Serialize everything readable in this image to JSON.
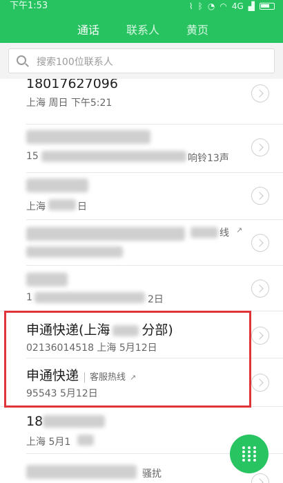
{
  "status": {
    "time": "下午1:53",
    "signal": "4G"
  },
  "tabs": [
    {
      "label": "通话",
      "active": true
    },
    {
      "label": "联系人",
      "active": false
    },
    {
      "label": "黄页",
      "active": false
    }
  ],
  "search": {
    "placeholder": "搜索100位联系人"
  },
  "calls": [
    {
      "line1": "18017627096",
      "line2": "上海 周日 下午5:21"
    },
    {
      "line1": "",
      "line2": "15",
      "extra": "响铃13声"
    },
    {
      "line1": "",
      "line2": "上海",
      "extra": "日"
    },
    {
      "line1": "",
      "line2": "",
      "extra": "线"
    },
    {
      "line1": "",
      "line2": "1",
      "extra": "2日"
    },
    {
      "line1": "申通快递(上海",
      "line1_tail": "分部)",
      "line2": "02136014518 上海 5月12日"
    },
    {
      "line1": "申通快递",
      "tag": "客服热线",
      "line2": "95543 5月12日"
    },
    {
      "line1": "18",
      "line2": "上海 5月1"
    },
    {
      "line1": "",
      "line2": "",
      "extra": "骚扰"
    }
  ],
  "colors": {
    "brand_green": "#27c360",
    "highlight_red": "#e0343a"
  }
}
